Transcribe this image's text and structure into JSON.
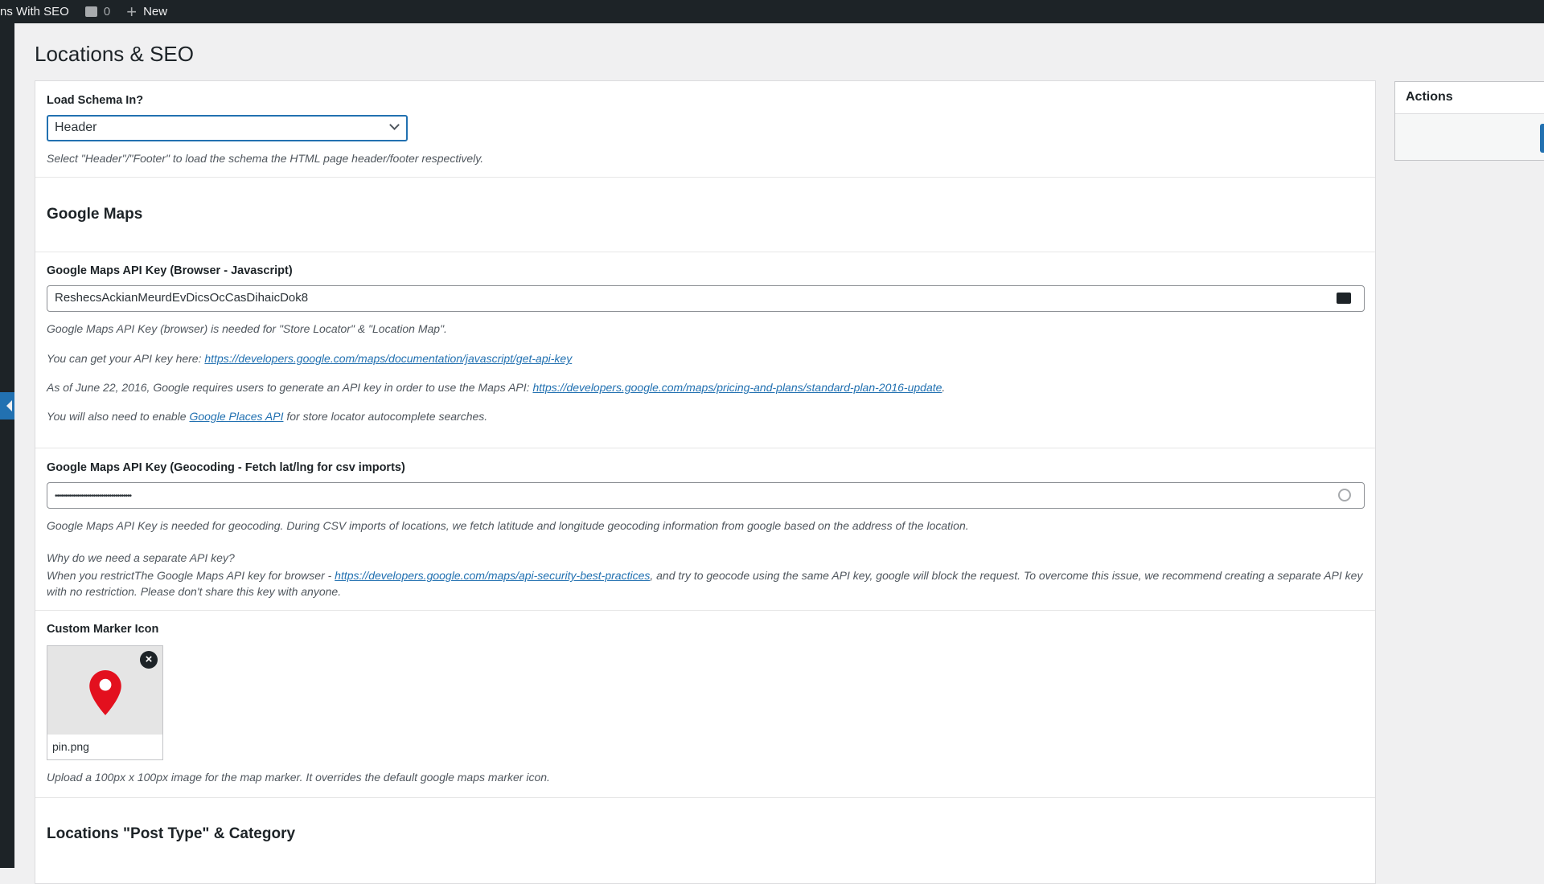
{
  "adminbar": {
    "site_name": "ns With SEO",
    "comments_count": "0",
    "new_label": "New"
  },
  "page_title": "Locations & SEO",
  "schema": {
    "label": "Load Schema In?",
    "value": "Header",
    "hint": "Select \"Header\"/\"Footer\" to load the schema the HTML page header/footer respectively."
  },
  "google_maps": {
    "heading": "Google Maps",
    "browser_key": {
      "label": "Google Maps API Key (Browser - Javascript)",
      "value": "ReshecsAckianMeurdEvDicsOcCasDihaicDok8",
      "hint1": "Google Maps API Key (browser) is needed for \"Store Locator\" & \"Location Map\".",
      "hint2_prefix": "You can get your API key here: ",
      "hint2_link": "https://developers.google.com/maps/documentation/javascript/get-api-key",
      "hint3_prefix": "As of June 22, 2016, Google requires users to generate an API key in order to use the Maps API: ",
      "hint3_link": "https://developers.google.com/maps/pricing-and-plans/standard-plan-2016-update",
      "hint3_suffix": ".",
      "hint4_prefix": "You will also need to enable ",
      "hint4_link": "Google Places API",
      "hint4_suffix": " for store locator autocomplete searches."
    },
    "geocoding_key": {
      "label": "Google Maps API Key (Geocoding - Fetch lat/lng for csv imports)",
      "value": "••••••••••••••••••••••••••••••••••••••",
      "hint1": "Google Maps API Key is needed for geocoding. During CSV imports of locations, we fetch latitude and longitude geocoding information from google based on the address of the location.",
      "hint2": "Why do we need a separate API key?",
      "hint3_prefix": "When you restrictThe Google Maps API key for browser - ",
      "hint3_link": "https://developers.google.com/maps/api-security-best-practices",
      "hint3_suffix": ", and try to geocode using the same API key, google will block the request. To overcome this issue, we recommend creating a separate API key with no restriction. Please don't share this key with anyone."
    },
    "marker": {
      "label": "Custom Marker Icon",
      "filename": "pin.png",
      "hint": "Upload a 100px x 100px image for the map marker. It overrides the default google maps marker icon.",
      "pin_color": "#e3101e"
    }
  },
  "post_type_heading": "Locations \"Post Type\" & Category",
  "actions": {
    "title": "Actions"
  },
  "colors": {
    "accent": "#2271b1",
    "adminbar": "#1d2327"
  }
}
